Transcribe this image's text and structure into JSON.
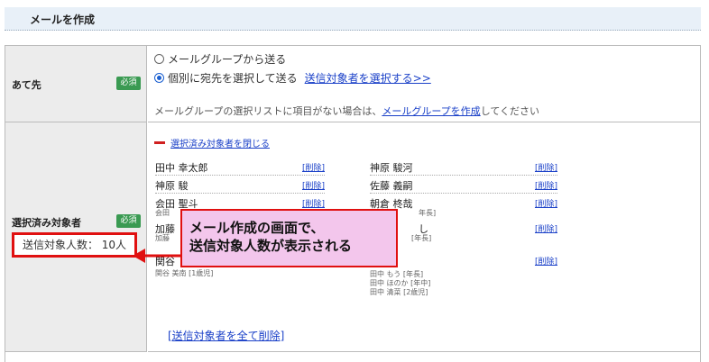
{
  "header": {
    "title": "メールを作成"
  },
  "recipient": {
    "label": "あて先",
    "required": "必須",
    "option_group": "メールグループから送る",
    "option_individual": "個別に宛先を選択して送る",
    "select_link": "送信対象者を選択する>>",
    "note_prefix": "メールグループの選択リストに項目がない場合は、",
    "note_link": "メールグループを作成",
    "note_suffix": "してください"
  },
  "selected": {
    "label": "選択済み対象者",
    "required": "必須",
    "count_text": "送信対象人数： 10人",
    "toggle_link": "選択済み対象者を閉じる",
    "delete_label": "[削除]",
    "delete_all": "[送信対象者を全て削除]",
    "left_people": [
      {
        "name": "田中 幸太郎",
        "sub": ""
      },
      {
        "name": "神原 駿",
        "sub": ""
      },
      {
        "name": "会田 聖斗",
        "sub": "会田"
      },
      {
        "name": "加藤",
        "sub": "加藤"
      },
      {
        "name": "関谷",
        "sub": "関谷 美南 [1歳児]"
      }
    ],
    "right_people": [
      {
        "name": "神原 駿河",
        "sub": ""
      },
      {
        "name": "佐藤 義嗣",
        "sub": ""
      },
      {
        "name": "朝倉 柊哉",
        "sub": "年長]"
      },
      {
        "name": "し",
        "sub": "[年長]"
      },
      {
        "name": "",
        "sub": "田中 もう [年長]"
      }
    ],
    "right_extra_subs": [
      "田中 ほのか [年中]",
      "田中 清菜 [2歳児]"
    ]
  },
  "callout": {
    "line1": "メール作成の画面で、",
    "line2": "送信対象人数が表示される"
  },
  "colors": {
    "accent_red": "#e01010",
    "callout_bg": "#f3c6ec",
    "required_green": "#3a9a52",
    "link_blue": "#1a40c8"
  }
}
